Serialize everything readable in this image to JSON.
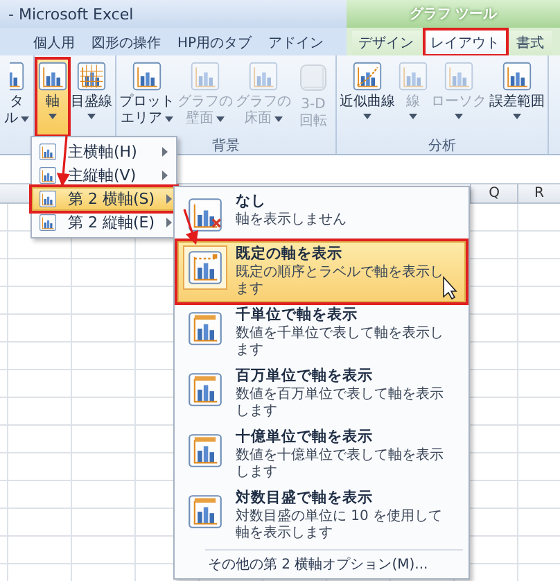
{
  "window": {
    "title": "- Microsoft Excel",
    "context_group": "グラフ ツール"
  },
  "tabs": [
    {
      "label": "個人用",
      "selected": false,
      "contextual": false
    },
    {
      "label": "図形の操作",
      "selected": false,
      "contextual": false
    },
    {
      "label": "HP用のタブ",
      "selected": false,
      "contextual": false
    },
    {
      "label": "アドイン",
      "selected": false,
      "contextual": false
    },
    {
      "label": "デザイン",
      "selected": false,
      "contextual": true
    },
    {
      "label": "レイアウト",
      "selected": true,
      "contextual": true
    },
    {
      "label": "書式",
      "selected": false,
      "contextual": true
    }
  ],
  "ribbon": {
    "groups": [
      {
        "buttons": [
          {
            "lines": [
              "タ",
              "ル"
            ],
            "dropdown": true,
            "selected": false,
            "disabled": false
          }
        ]
      },
      {
        "buttons": [
          {
            "lines": [
              "軸"
            ],
            "dropdown": true,
            "selected": true,
            "disabled": false
          },
          {
            "lines": [
              "目盛線"
            ],
            "dropdown": true,
            "selected": false,
            "disabled": false
          }
        ]
      },
      {
        "label": "背景",
        "buttons": [
          {
            "lines": [
              "プロット",
              "エリア"
            ],
            "dropdown": true,
            "selected": false,
            "disabled": false
          },
          {
            "lines": [
              "グラフの",
              "壁面"
            ],
            "dropdown": true,
            "selected": false,
            "disabled": true
          },
          {
            "lines": [
              "グラフの",
              "床面"
            ],
            "dropdown": true,
            "selected": false,
            "disabled": true
          },
          {
            "lines": [
              "3-D 回転"
            ],
            "dropdown": false,
            "selected": false,
            "disabled": true
          }
        ]
      },
      {
        "label": "分析",
        "buttons": [
          {
            "lines": [
              "近似曲線"
            ],
            "dropdown": true,
            "selected": false,
            "disabled": false
          },
          {
            "lines": [
              "線"
            ],
            "dropdown": true,
            "selected": false,
            "disabled": true
          },
          {
            "lines": [
              "ローソク"
            ],
            "dropdown": true,
            "selected": false,
            "disabled": true
          },
          {
            "lines": [
              "誤差範囲"
            ],
            "dropdown": true,
            "selected": false,
            "disabled": false
          }
        ]
      }
    ]
  },
  "sheet": {
    "column_headers": [
      "Q",
      "R"
    ]
  },
  "axis_menu": {
    "items": [
      {
        "label": "主横軸(H)",
        "selected": false
      },
      {
        "label": "主縦軸(V)",
        "selected": false
      },
      {
        "label": "第 2 横軸(S)",
        "selected": true
      },
      {
        "label": "第 2 縦軸(E)",
        "selected": false
      }
    ]
  },
  "secondary_axis_menu": {
    "items": [
      {
        "title": "なし",
        "description": "軸を表示しません",
        "selected": false
      },
      {
        "title": "既定の軸を表示",
        "description": "既定の順序とラベルで軸を表示します",
        "selected": true
      },
      {
        "title": "千単位で軸を表示",
        "description": "数値を千単位で表して軸を表示します",
        "selected": false
      },
      {
        "title": "百万単位で軸を表示",
        "description": "数値を百万単位で表して軸を表示します",
        "selected": false
      },
      {
        "title": "十億単位で軸を表示",
        "description": "数値を十億単位で表して軸を表示します",
        "selected": false
      },
      {
        "title": "対数目盛で軸を表示",
        "description": "対数目盛の単位に 10 を使用して軸を表示します",
        "selected": false
      }
    ],
    "more_options": "その他の第 2 横軸オプション(M)..."
  }
}
